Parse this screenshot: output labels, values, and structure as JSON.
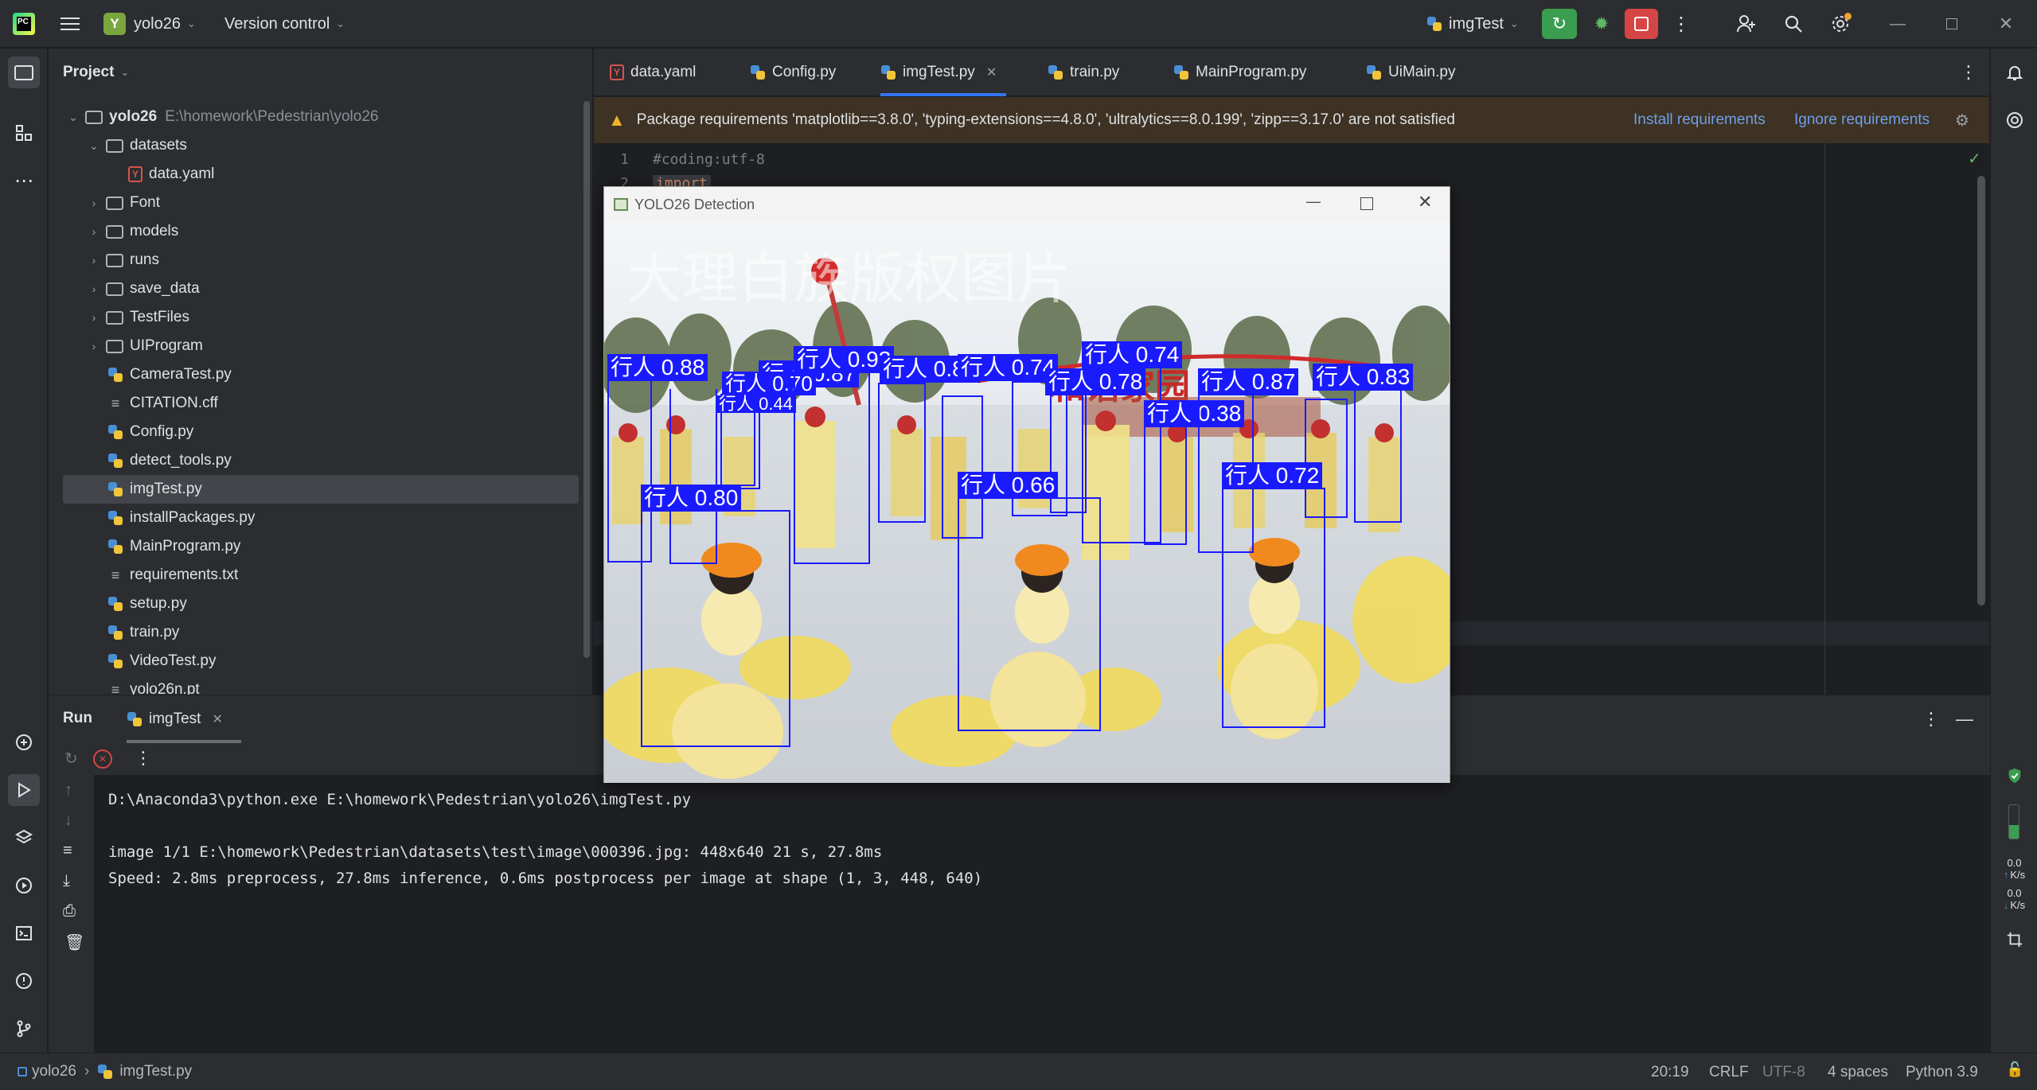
{
  "titlebar": {
    "project_initial": "Y",
    "project_name": "yolo26",
    "vcs_label": "Version control",
    "run_config": "imgTest"
  },
  "project_panel": {
    "title": "Project",
    "root_name": "yolo26",
    "root_path": "E:\\homework\\Pedestrian\\yolo26",
    "items": [
      {
        "label": "datasets"
      },
      {
        "label": "data.yaml"
      },
      {
        "label": "Font"
      },
      {
        "label": "models"
      },
      {
        "label": "runs"
      },
      {
        "label": "save_data"
      },
      {
        "label": "TestFiles"
      },
      {
        "label": "UIProgram"
      },
      {
        "label": "CameraTest.py"
      },
      {
        "label": "CITATION.cff"
      },
      {
        "label": "Config.py"
      },
      {
        "label": "detect_tools.py"
      },
      {
        "label": "imgTest.py"
      },
      {
        "label": "installPackages.py"
      },
      {
        "label": "MainProgram.py"
      },
      {
        "label": "requirements.txt"
      },
      {
        "label": "setup.py"
      },
      {
        "label": "train.py"
      },
      {
        "label": "VideoTest.py"
      },
      {
        "label": "yolo26n.pt"
      }
    ]
  },
  "editor": {
    "tabs": [
      {
        "label": "data.yaml"
      },
      {
        "label": "Config.py"
      },
      {
        "label": "imgTest.py"
      },
      {
        "label": "train.py"
      },
      {
        "label": "MainProgram.py"
      },
      {
        "label": "UiMain.py"
      }
    ],
    "banner": {
      "message": "Package requirements 'matplotlib==3.8.0', 'typing-extensions==4.8.0', 'ultralytics==8.0.199', 'zipp==3.17.0' are not satisfied",
      "install": "Install requirements",
      "ignore": "Ignore requirements"
    },
    "lines": [
      {
        "num": "1",
        "code": "#coding:utf-8"
      },
      {
        "num": "2",
        "code": "import"
      }
    ]
  },
  "detection_window": {
    "title": "YOLO26 Detection",
    "watermark": "大理白族版权图片",
    "banner_text": "和谐家园",
    "detections": [
      {
        "label": "行人 0.88"
      },
      {
        "label": "行人 0.87"
      },
      {
        "label": "行人 0.70"
      },
      {
        "label": "行人 0.44"
      },
      {
        "label": "行人 0.93"
      },
      {
        "label": "行人 0.87"
      },
      {
        "label": "行人 0.74"
      },
      {
        "label": "行人 0.74"
      },
      {
        "label": "行人 0.78"
      },
      {
        "label": "行人 0.38"
      },
      {
        "label": "行人 0.87"
      },
      {
        "label": "行人 0.83"
      },
      {
        "label": "行人 0.80"
      },
      {
        "label": "行人 0.66"
      },
      {
        "label": "行人 0.72"
      }
    ]
  },
  "run_panel": {
    "title": "Run",
    "tab": "imgTest",
    "console": [
      "D:\\Anaconda3\\python.exe E:\\homework\\Pedestrian\\yolo26\\imgTest.py",
      "",
      "image 1/1 E:\\homework\\Pedestrian\\datasets\\test\\image\\000396.jpg: 448x640 21 s, 27.8ms",
      "Speed: 2.8ms preprocess, 27.8ms inference, 0.6ms postprocess per image at shape (1, 3, 448, 640)"
    ]
  },
  "right_strip": {
    "net_up": "0.0",
    "net_up_unit": "K/s",
    "net_down": "0.0",
    "net_down_unit": "K/s"
  },
  "status_bar": {
    "project": "yolo26",
    "file": "imgTest.py",
    "position": "20:19",
    "line_sep": "CRLF",
    "encoding": "UTF-8",
    "indent": "4 spaces",
    "interpreter": "Python 3.9"
  },
  "colors": {
    "accent": "#3574f0",
    "run_green": "#3a9d4f",
    "stop_red": "#d64545",
    "warning_bg": "#3d3223",
    "detection_blue": "#1a1aff"
  }
}
